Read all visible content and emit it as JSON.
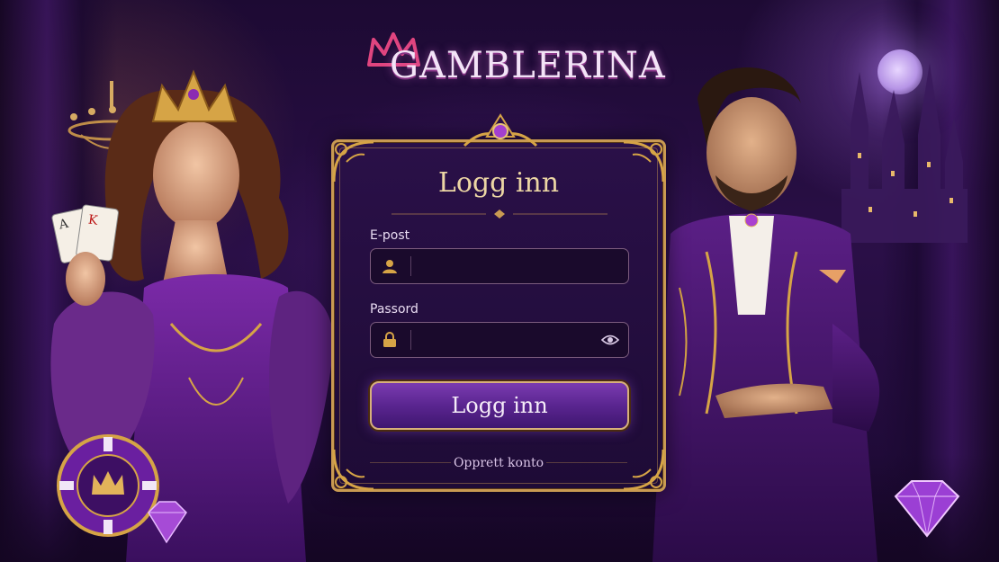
{
  "brand": {
    "name": "GAMBLERINA"
  },
  "login": {
    "title": "Logg inn",
    "email_label": "E-post",
    "email_value": "",
    "password_label": "Passord",
    "password_value": "",
    "submit_label": "Logg inn",
    "signup_link": "Opprett konto"
  },
  "icons": {
    "email_field": "user-icon",
    "password_field": "lock-icon",
    "password_toggle": "eye-icon"
  },
  "colors": {
    "gold_accent": "#c99a52",
    "panel_bg": "#1e0b36",
    "button_purple": "#5a2590",
    "title_text": "#ecd6a4"
  }
}
